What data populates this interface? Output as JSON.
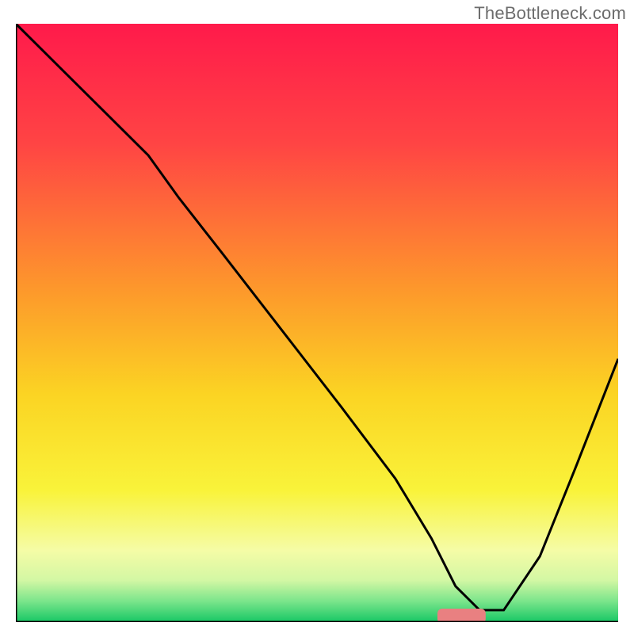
{
  "watermark": "TheBottleneck.com",
  "chart_data": {
    "type": "line",
    "title": "",
    "xlabel": "",
    "ylabel": "",
    "xlim": [
      0,
      100
    ],
    "ylim": [
      0,
      100
    ],
    "grid": false,
    "legend": false,
    "background_gradient": {
      "stops": [
        {
          "offset": 0.0,
          "color": "#ff1a4b"
        },
        {
          "offset": 0.2,
          "color": "#ff4444"
        },
        {
          "offset": 0.45,
          "color": "#fd9a2b"
        },
        {
          "offset": 0.62,
          "color": "#fbd423"
        },
        {
          "offset": 0.78,
          "color": "#f9f33a"
        },
        {
          "offset": 0.88,
          "color": "#f5fca6"
        },
        {
          "offset": 0.93,
          "color": "#d3f7a4"
        },
        {
          "offset": 0.965,
          "color": "#7be58b"
        },
        {
          "offset": 1.0,
          "color": "#17c765"
        }
      ]
    },
    "series": [
      {
        "name": "bottleneck-curve",
        "color": "#000000",
        "x": [
          0,
          8,
          22,
          27,
          34,
          44,
          54,
          63,
          69,
          73,
          77,
          81,
          87,
          93,
          100
        ],
        "values": [
          100,
          92,
          78,
          71,
          62,
          49,
          36,
          24,
          14,
          6,
          2,
          2,
          11,
          26,
          44
        ]
      }
    ],
    "marker": {
      "name": "optimal-pill",
      "shape": "rounded-rect",
      "color": "#e98081",
      "x_center": 74,
      "width_x": 8,
      "y_center": 1,
      "height_y": 2.5
    },
    "axes_frame": {
      "left": true,
      "bottom": true,
      "right": false,
      "top": false,
      "color": "#000000",
      "stroke_width": 3
    }
  }
}
